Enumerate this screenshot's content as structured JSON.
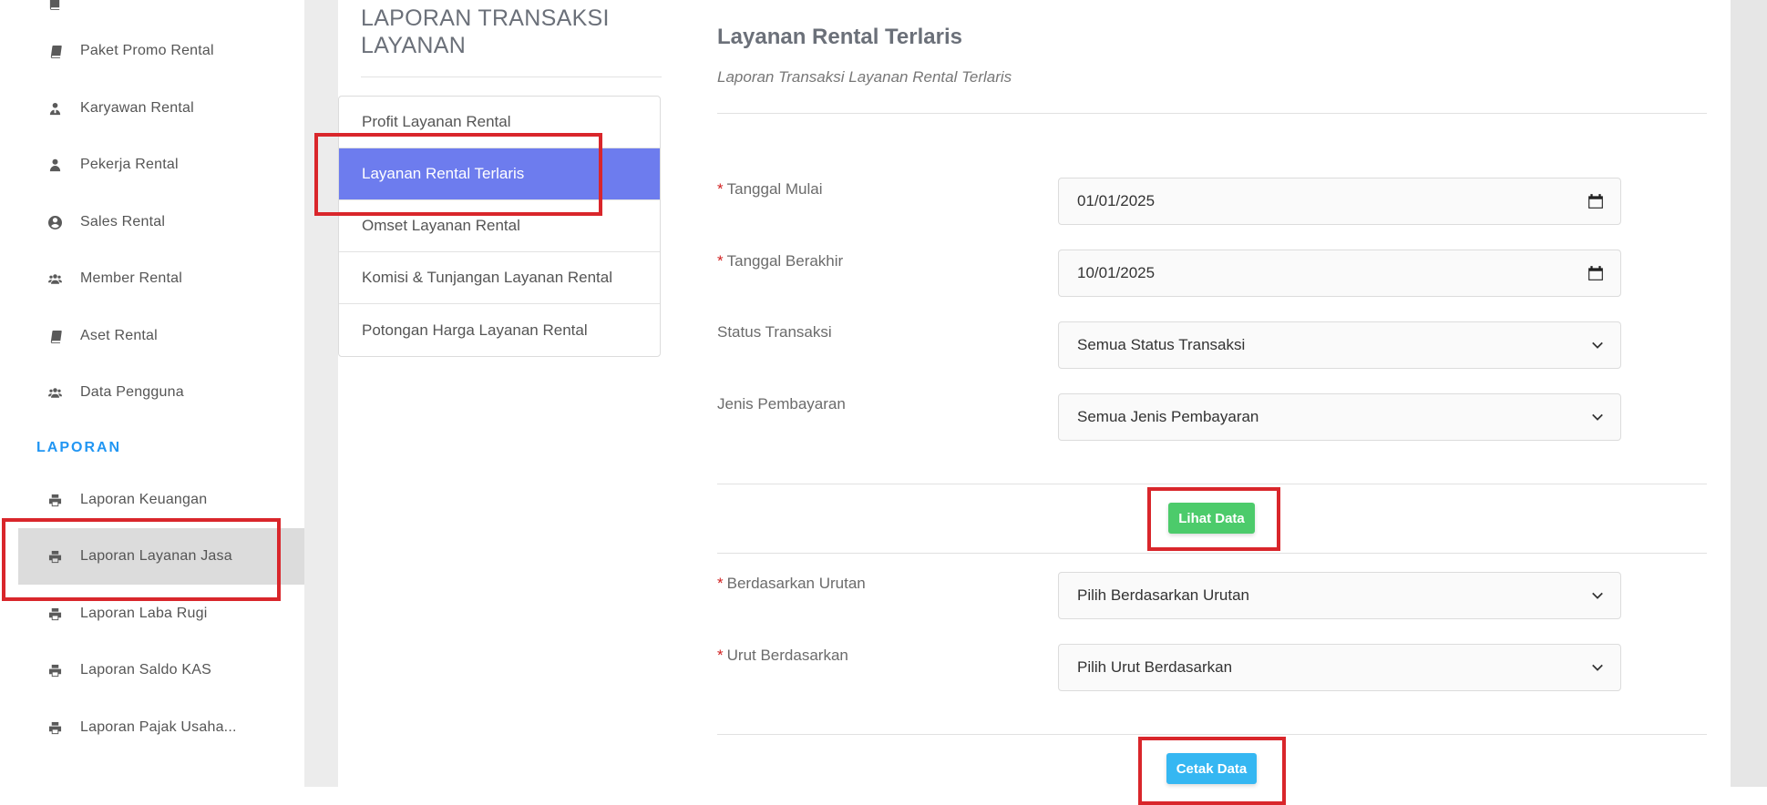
{
  "sidebar": {
    "items": [
      {
        "label": "Paket Promo Rental",
        "icon": "book-icon"
      },
      {
        "label": "Karyawan Rental",
        "icon": "user-tie-icon"
      },
      {
        "label": "Pekerja Rental",
        "icon": "user-icon"
      },
      {
        "label": "Sales Rental",
        "icon": "user-circle-icon"
      },
      {
        "label": "Member Rental",
        "icon": "users-icon"
      },
      {
        "label": "Aset Rental",
        "icon": "book-icon"
      },
      {
        "label": "Data Pengguna",
        "icon": "users-icon"
      }
    ],
    "section_label": "LAPORAN",
    "report_items": [
      {
        "label": "Laporan Keuangan",
        "icon": "printer-icon"
      },
      {
        "label": "Laporan Layanan Jasa",
        "icon": "printer-icon"
      },
      {
        "label": "Laporan Laba Rugi",
        "icon": "printer-icon"
      },
      {
        "label": "Laporan Saldo KAS",
        "icon": "printer-icon"
      },
      {
        "label": "Laporan Pajak Usaha...",
        "icon": "printer-icon"
      }
    ]
  },
  "report_menu": {
    "title": "LAPORAN TRANSAKSI LAYANAN",
    "items": [
      {
        "label": "Profit Layanan Rental"
      },
      {
        "label": "Layanan Rental Terlaris"
      },
      {
        "label": "Omset Layanan Rental"
      },
      {
        "label": "Komisi & Tunjangan Layanan Rental"
      },
      {
        "label": "Potongan Harga Layanan Rental"
      }
    ]
  },
  "content": {
    "title": "Layanan Rental Terlaris",
    "subtitle": "Laporan Transaksi Layanan Rental Terlaris",
    "required_mark": "*",
    "fields": {
      "start_date": {
        "label": "Tanggal Mulai",
        "value": "01/01/2025"
      },
      "end_date": {
        "label": "Tanggal Berakhir",
        "value": "10/01/2025"
      },
      "status": {
        "label": "Status Transaksi",
        "value": "Semua Status Transaksi"
      },
      "payment": {
        "label": "Jenis Pembayaran",
        "value": "Semua Jenis Pembayaran"
      },
      "order_by": {
        "label": "Berdasarkan Urutan",
        "value": "Pilih Berdasarkan Urutan"
      },
      "sort_by": {
        "label": "Urut Berdasarkan",
        "value": "Pilih Urut Berdasarkan"
      }
    },
    "view_button": "Lihat Data",
    "print_button": "Cetak Data"
  },
  "colors": {
    "accent_blue": "#2196f3",
    "active_menu": "#6d7cee",
    "highlight_red": "#d9262b",
    "button_green": "#4ccb6b",
    "button_blue": "#35b7f2"
  }
}
